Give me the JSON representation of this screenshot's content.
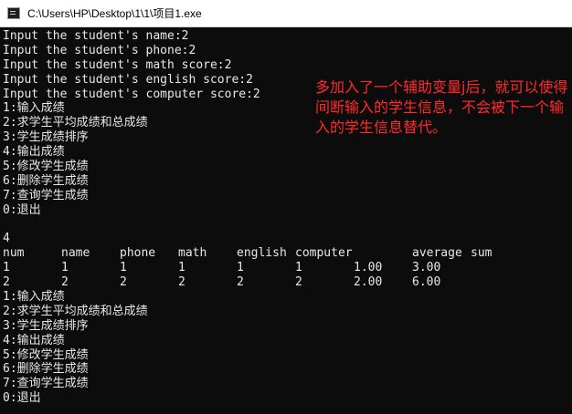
{
  "window": {
    "title": "C:\\Users\\HP\\Desktop\\1\\1\\项目1.exe",
    "colors": {
      "background": "#0c0c0c",
      "text": "#e8e8e8",
      "annotation": "#ff2a2a"
    }
  },
  "console": {
    "input_lines": [
      "Input the student's name:2",
      "Input the student's phone:2",
      "Input the student's math score:2",
      "Input the student's english score:2",
      "Input the student's computer score:2"
    ],
    "menu_first": [
      "1:输入成绩",
      "2:求学生平均成绩和总成绩",
      "3:学生成绩排序",
      "4:输出成绩",
      "5:修改学生成绩",
      "6:删除学生成绩",
      "7:查询学生成绩",
      "0:退出"
    ],
    "blank_line": "",
    "choice": "4",
    "table": {
      "headers": [
        "num",
        "name",
        "phone",
        "math",
        "english",
        "computer",
        "average",
        "sum"
      ],
      "rows": [
        [
          "1",
          "1",
          "1",
          "1",
          "1",
          "1",
          "1.00",
          "3.00"
        ],
        [
          "2",
          "2",
          "2",
          "2",
          "2",
          "2",
          "2.00",
          "6.00"
        ]
      ]
    },
    "menu_second": [
      "1:输入成绩",
      "2:求学生平均成绩和总成绩",
      "3:学生成绩排序",
      "4:输出成绩",
      "5:修改学生成绩",
      "6:删除学生成绩",
      "7:查询学生成绩",
      "0:退出"
    ]
  },
  "annotation": {
    "text": "多加入了一个辅助变量j后，就可以使得间断输入的学生信息，不会被下一个输入的学生信息替代。"
  }
}
